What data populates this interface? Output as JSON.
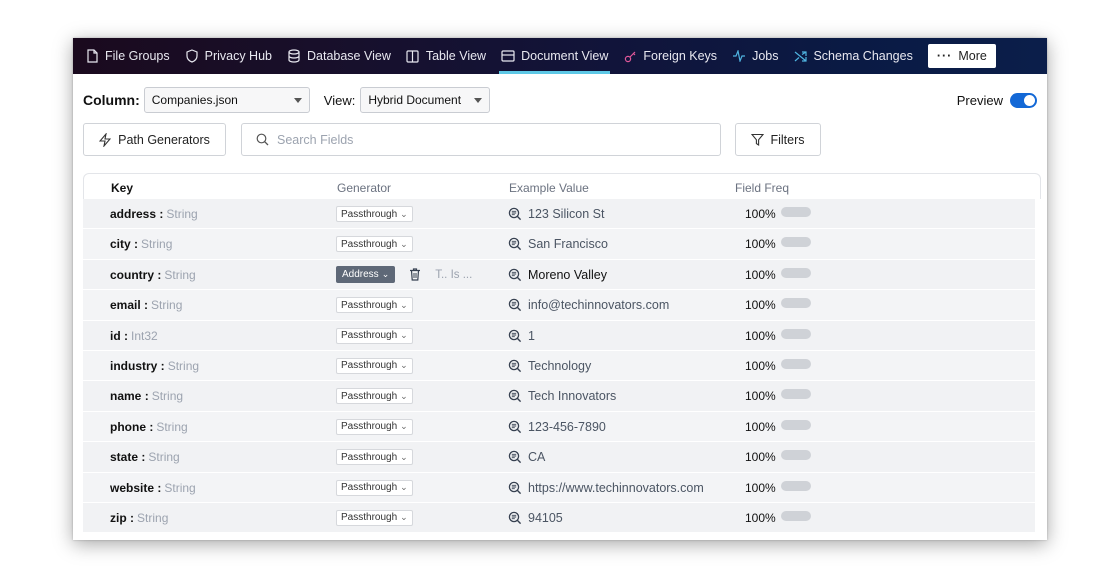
{
  "nav": {
    "items": [
      {
        "label": "File Groups",
        "icon": "file-icon"
      },
      {
        "label": "Privacy Hub",
        "icon": "shield-icon"
      },
      {
        "label": "Database View",
        "icon": "database-icon"
      },
      {
        "label": "Table View",
        "icon": "columns-icon"
      },
      {
        "label": "Document View",
        "icon": "document-view-icon",
        "active": true
      },
      {
        "label": "Foreign Keys",
        "icon": "key-icon"
      },
      {
        "label": "Jobs",
        "icon": "activity-icon"
      },
      {
        "label": "Schema Changes",
        "icon": "shuffle-icon"
      }
    ],
    "more_label": "More",
    "accent_color": "#5ec8e6"
  },
  "toolbar": {
    "column_label": "Column:",
    "column_value": "Companies.json",
    "view_label": "View:",
    "view_value": "Hybrid Document",
    "preview_label": "Preview",
    "preview_on": true,
    "path_generators_label": "Path Generators",
    "search_placeholder": "Search Fields",
    "filters_label": "Filters"
  },
  "table": {
    "headers": {
      "key": "Key",
      "generator": "Generator",
      "example": "Example Value",
      "freq": "Field Freq"
    },
    "rows": [
      {
        "key": "address",
        "type": "String",
        "generator": "Passthrough",
        "example": "123 Silicon St",
        "freq": "100%"
      },
      {
        "key": "city",
        "type": "String",
        "generator": "Passthrough",
        "example": "San Francisco",
        "freq": "100%"
      },
      {
        "key": "country",
        "type": "String",
        "generator": "Address",
        "example": "Moreno Valley",
        "freq": "100%",
        "selected": true,
        "extra": "T..  Is ..."
      },
      {
        "key": "email",
        "type": "String",
        "generator": "Passthrough",
        "example": "info@techinnovators.com",
        "freq": "100%"
      },
      {
        "key": "id",
        "type": "Int32",
        "generator": "Passthrough",
        "example": "1",
        "freq": "100%"
      },
      {
        "key": "industry",
        "type": "String",
        "generator": "Passthrough",
        "example": "Technology",
        "freq": "100%"
      },
      {
        "key": "name",
        "type": "String",
        "generator": "Passthrough",
        "example": "Tech Innovators",
        "freq": "100%"
      },
      {
        "key": "phone",
        "type": "String",
        "generator": "Passthrough",
        "example": "123-456-7890",
        "freq": "100%"
      },
      {
        "key": "state",
        "type": "String",
        "generator": "Passthrough",
        "example": "CA",
        "freq": "100%"
      },
      {
        "key": "website",
        "type": "String",
        "generator": "Passthrough",
        "example": "https://www.techinnovators.com",
        "freq": "100%"
      },
      {
        "key": "zip",
        "type": "String",
        "generator": "Passthrough",
        "example": "94105",
        "freq": "100%"
      }
    ]
  }
}
